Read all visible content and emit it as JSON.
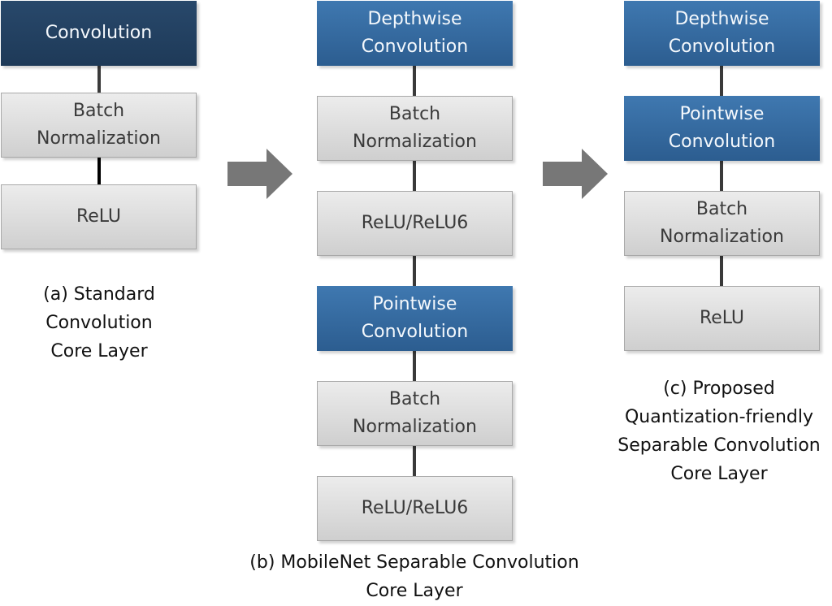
{
  "colors": {
    "standard_conv": "#22405f",
    "separable_conv": "#3a6ea5",
    "generic_layer": "#dcdcdc",
    "arrow": "#777777"
  },
  "column_a": {
    "blocks": [
      "Convolution",
      "Batch Normalization",
      "ReLU"
    ],
    "caption": [
      "(a) Standard",
      "Convolution",
      "Core Layer"
    ]
  },
  "column_b": {
    "blocks": [
      "Depthwise Convolution",
      "Batch Normalization",
      "ReLU/ReLU6",
      "Pointwise Convolution",
      "Batch Normalization",
      "ReLU/ReLU6"
    ],
    "caption": [
      "(b) MobileNet Separable Convolution",
      "Core Layer"
    ]
  },
  "column_c": {
    "blocks": [
      "Depthwise Convolution",
      "Pointwise Convolution",
      "Batch Normalization",
      "ReLU"
    ],
    "caption": [
      "(c) Proposed",
      "Quantization-friendly",
      "Separable Convolution",
      "Core Layer"
    ]
  }
}
